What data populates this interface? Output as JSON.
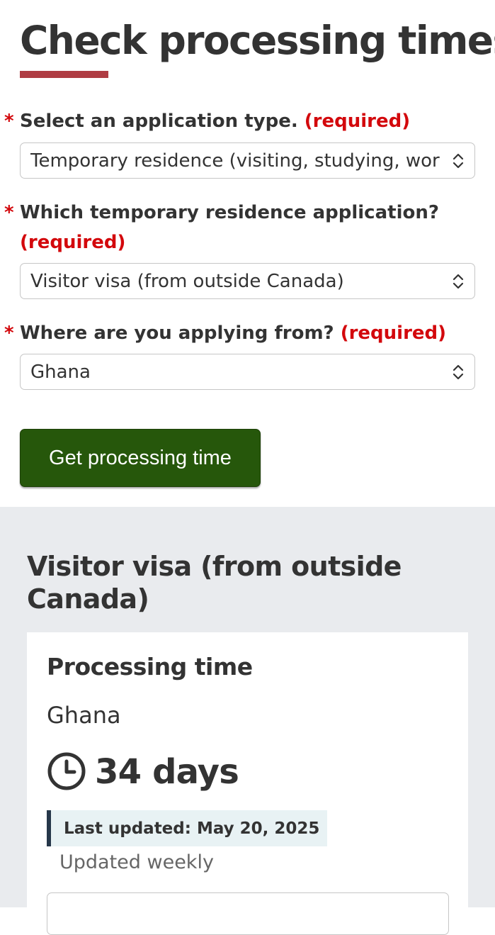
{
  "page": {
    "title": "Check processing times"
  },
  "form": {
    "application_type": {
      "label": "Select an application type.",
      "required_text": "(required)",
      "value": "Temporary residence (visiting, studying, working)"
    },
    "temporary_residence_application": {
      "label": "Which temporary residence application?",
      "required_text": "(required)",
      "value": "Visitor visa (from outside Canada)"
    },
    "applying_from": {
      "label": "Where are you applying from?",
      "required_text": "(required)",
      "value": "Ghana"
    },
    "submit_label": "Get processing time"
  },
  "results": {
    "heading": "Visitor visa (from outside Canada)",
    "card_title": "Processing time",
    "country": "Ghana",
    "duration": "34 days",
    "last_updated": "Last updated: May 20, 2025",
    "frequency": "Updated weekly"
  },
  "colors": {
    "accent_underline": "#af3c43",
    "required_red": "#d3080c",
    "button_green": "#26570b",
    "panel_gray": "#e9ebee",
    "update_box_bg": "#e8f2f4",
    "update_box_border": "#26374a"
  },
  "icons": {
    "select_indicator": "chevron-updown-icon",
    "duration": "clock-icon"
  }
}
